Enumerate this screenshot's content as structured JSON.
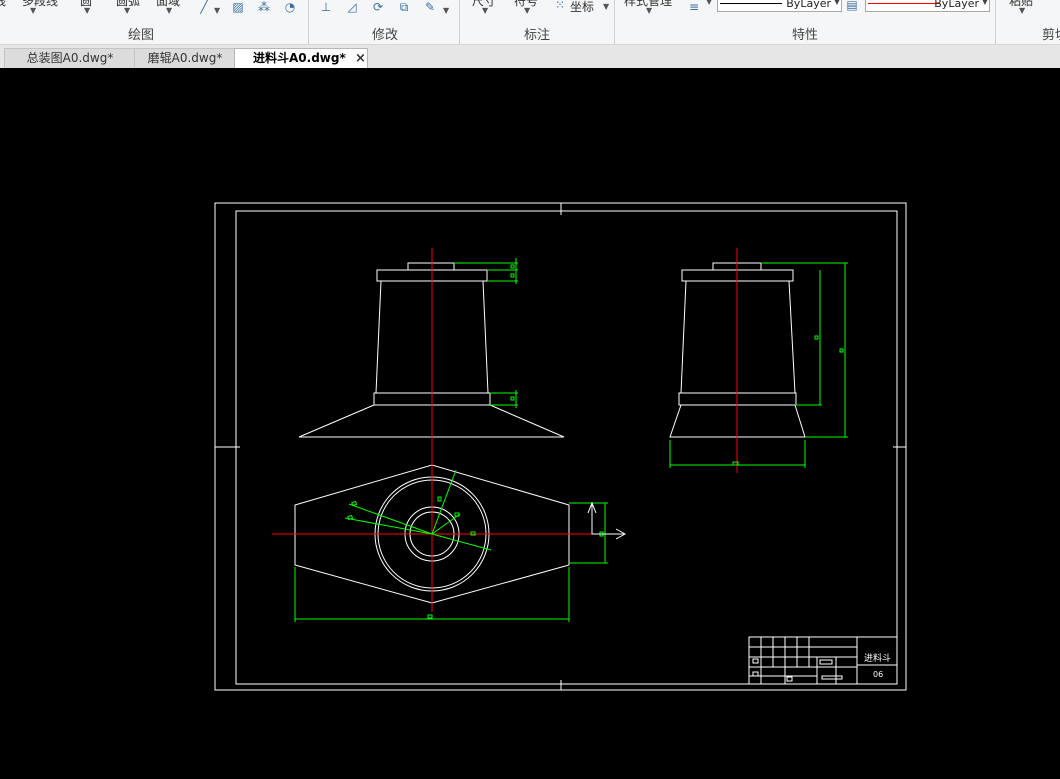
{
  "ribbon": {
    "top_labels": [
      "线",
      "多段线",
      "圆",
      "圆弧",
      "面域"
    ],
    "groups": {
      "draw": "绘图",
      "modify": "修改",
      "annotate": "标注",
      "properties": "特性",
      "clipboard": "剪切"
    },
    "annotate_items": [
      "尺寸",
      "符号",
      "坐标"
    ],
    "style_manager": "样式管理",
    "linetype_value": "ByLayer",
    "color_value": "ByLayer",
    "paste_label": "粘贴",
    "colors": {
      "linetype": "#000000",
      "color": "#ff0000"
    }
  },
  "tabs": [
    {
      "label": "总装图A0.dwg*",
      "active": false
    },
    {
      "label": "磨辊A0.dwg*",
      "active": false
    },
    {
      "label": "进料斗A0.dwg*",
      "active": true
    }
  ],
  "tab_close_glyph": "×",
  "drawing": {
    "background": "#000000",
    "colors": {
      "outline": "#ffffff",
      "centerline": "#ff0000",
      "dimension": "#00ff00"
    },
    "title_block_texts": [
      "进料斗",
      "06"
    ]
  }
}
